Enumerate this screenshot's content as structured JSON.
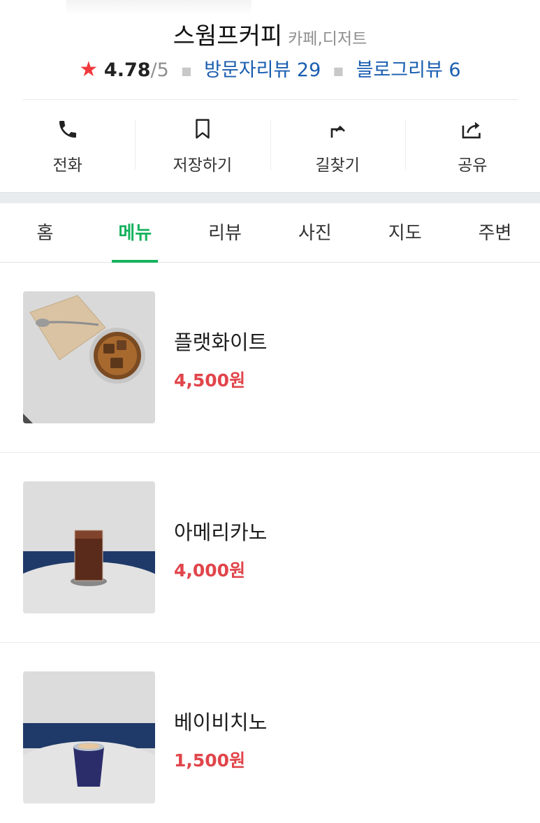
{
  "place": {
    "name": "스웜프커피",
    "category": "카페,디저트",
    "rating_value": "4.78",
    "rating_max": "/5",
    "visitor_reviews": "방문자리뷰 29",
    "blog_reviews": "블로그리뷰 6"
  },
  "actions": [
    {
      "label": "전화",
      "icon": "phone-icon"
    },
    {
      "label": "저장하기",
      "icon": "bookmark-icon"
    },
    {
      "label": "길찾기",
      "icon": "directions-icon"
    },
    {
      "label": "공유",
      "icon": "share-icon"
    }
  ],
  "tabs": [
    {
      "label": "홈",
      "active": false
    },
    {
      "label": "메뉴",
      "active": true
    },
    {
      "label": "리뷰",
      "active": false
    },
    {
      "label": "사진",
      "active": false
    },
    {
      "label": "지도",
      "active": false
    },
    {
      "label": "주변",
      "active": false
    }
  ],
  "menu": [
    {
      "name": "플랫화이트",
      "price": "4,500원"
    },
    {
      "name": "아메리카노",
      "price": "4,000원"
    },
    {
      "name": "베이비치노",
      "price": "1,500원"
    }
  ],
  "colors": {
    "accent_green": "#17b25d",
    "price_red": "#e0454b",
    "link_blue": "#1a5eb0",
    "star_red": "#f2393e"
  }
}
